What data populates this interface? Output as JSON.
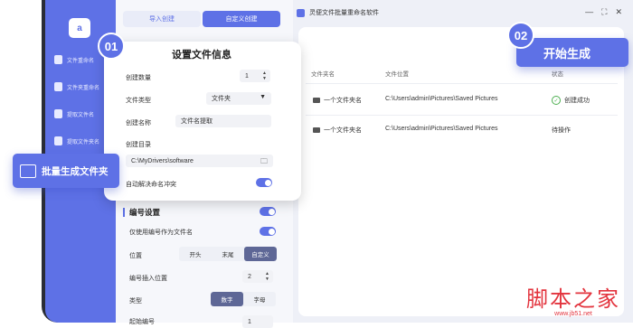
{
  "app": {
    "logo_text": "a",
    "window_title": "灵便文件批量重命名软件",
    "window_controls": [
      "—",
      "⛶",
      "✕"
    ]
  },
  "sidebar": {
    "items": [
      {
        "label": "文件重命名",
        "icon": "file-rename-icon"
      },
      {
        "label": "文件夹重命名",
        "icon": "folder-rename-icon"
      },
      {
        "label": "提取文件名",
        "icon": "extract-filename-icon"
      },
      {
        "label": "提取文件夹名",
        "icon": "extract-foldername-icon"
      }
    ]
  },
  "tabs": [
    {
      "label": "导入创建",
      "active": false
    },
    {
      "label": "自定义创建",
      "active": true
    }
  ],
  "step1": {
    "number": "01",
    "title": "设置文件信息",
    "count_label": "创建数量",
    "count_value": "1",
    "type_label": "文件类型",
    "type_value": "文件夹",
    "name_label": "创建名称",
    "name_value": "文件名提取",
    "dir_label": "创建目录",
    "dir_value": "C:\\MyDrivers\\software",
    "conflict_label": "自动解决命名冲突",
    "conflict_on": true
  },
  "callout_left": "批量生成文件夹",
  "step2": {
    "number": "02",
    "label": "开始生成"
  },
  "numbering": {
    "title": "编号设置",
    "enabled": true,
    "only_number_label": "仅使用编号作为文件名",
    "only_number_on": true,
    "position_label": "位置",
    "position_options": [
      "开头",
      "末尾",
      "自定义"
    ],
    "position_selected": "自定义",
    "insert_pos_label": "编号插入位置",
    "insert_pos_value": "2",
    "kind_label": "类型",
    "kind_options": [
      "数字",
      "字母"
    ],
    "kind_selected": "数字",
    "cut_label": "起始编号",
    "cut_value": "1"
  },
  "table": {
    "headers": [
      "文件夹名",
      "文件位置",
      "状态"
    ],
    "rows": [
      {
        "name": "一个文件夹名",
        "path": "C:\\Users\\admin\\Pictures\\Saved Pictures",
        "status": "创建成功",
        "status_ok": true
      },
      {
        "name": "一个文件夹名",
        "path": "C:\\Users\\admin\\Pictures\\Saved Pictures",
        "status": "待操作",
        "status_ok": false
      }
    ]
  },
  "watermark": {
    "big": "脚本之家",
    "small": "www.jb51.net"
  },
  "colors": {
    "accent": "#5e71e6",
    "success": "#4caf50",
    "watermark": "#e3343e"
  }
}
